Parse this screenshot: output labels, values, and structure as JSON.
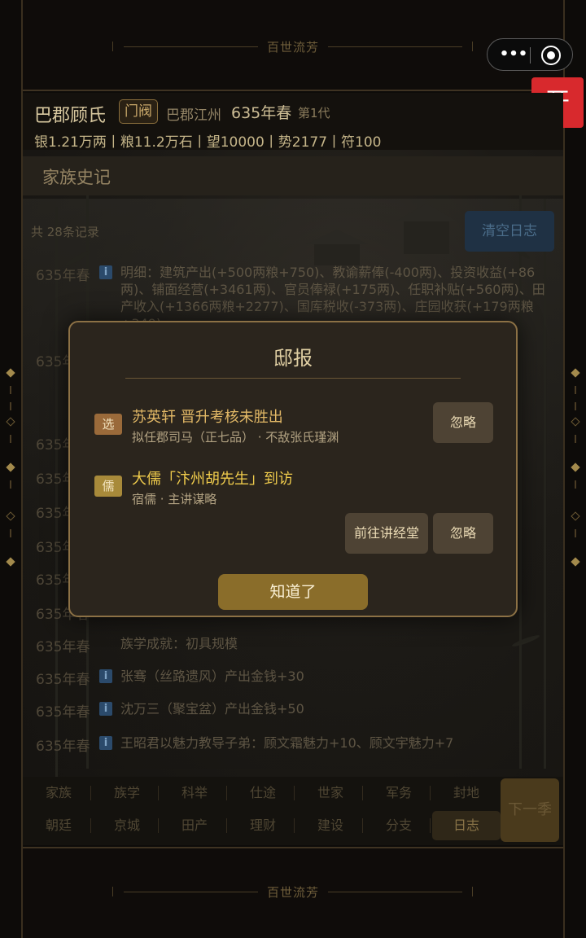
{
  "banner": {
    "title": "百世流芳"
  },
  "miniapp": {
    "more_icon": "more-dots-icon",
    "close_icon": "target-icon",
    "more_glyph": "•••"
  },
  "float_button": {
    "label": "开",
    "color": "#d8292d"
  },
  "family": {
    "name": "巴郡顾氏",
    "rank_badge": "门阀",
    "place": "巴郡江州",
    "year": "635年春",
    "generation": "第1代",
    "stats": "银1.21万两丨粮11.2万石丨望10000丨势2177丨符100"
  },
  "history": {
    "title": "家族史记",
    "record_count": "共 28条记录",
    "clear_label": "清空日志",
    "entries": [
      {
        "year": "635年春",
        "has_icon": true,
        "text": "明细：建筑产出(+500两粮+750)、教谕薪俸(-400两)、投资收益(+86两)、铺面经营(+3461两)、官员俸禄(+175两)、任职补贴(+560两)、田产收入(+1366两粮+2277)、国库税收(-373两)、庄园收获(+179两粮+349)"
      },
      {
        "year": "635年春",
        "has_icon": false,
        "text": ""
      },
      {
        "year": "635年春",
        "has_icon": false,
        "text": ""
      },
      {
        "year": "635年春",
        "has_icon": false,
        "text": ""
      },
      {
        "year": "635年春",
        "has_icon": false,
        "text": ""
      },
      {
        "year": "635年春",
        "has_icon": false,
        "text": ""
      },
      {
        "year": "635年春",
        "has_icon": false,
        "text": ""
      },
      {
        "year": "635年春",
        "has_icon": false,
        "text": ""
      },
      {
        "year": "635年春",
        "has_icon": false,
        "text": "族学成就：初具规模"
      },
      {
        "year": "635年春",
        "has_icon": true,
        "text": "张骞（丝路遗风）产出金钱+30"
      },
      {
        "year": "635年春",
        "has_icon": true,
        "text": "沈万三（聚宝盆）产出金钱+50"
      },
      {
        "year": "635年春",
        "has_icon": true,
        "text": "王昭君以魅力教导子弟：顾文霜魅力+10、顾文宇魅力+7"
      }
    ],
    "info_glyph": "i"
  },
  "tabs": {
    "row1": [
      "家族",
      "族学",
      "科举",
      "仕途",
      "世家",
      "军务",
      "封地"
    ],
    "row2": [
      "朝廷",
      "京城",
      "田产",
      "理财",
      "建设",
      "分支",
      "日志"
    ],
    "active": "日志",
    "next_label": "下一季"
  },
  "modal": {
    "title": "邸报",
    "items": [
      {
        "tag": "选",
        "tag_color": "#9a6a3a",
        "title": "苏英轩 晋升考核未胜出",
        "title_color": "#e2b866",
        "sub": "拟任郡司马（正七品） · 不敌张氏瑾渊",
        "ignore_label": "忽略"
      },
      {
        "tag": "儒",
        "tag_color": "#a88a3a",
        "title": "大儒「汴州胡先生」到访",
        "title_color": "#f0cc4c",
        "sub": "宿儒 · 主讲谋略",
        "go_label": "前往讲经堂",
        "ignore_label": "忽略"
      }
    ],
    "ok_label": "知道了"
  }
}
